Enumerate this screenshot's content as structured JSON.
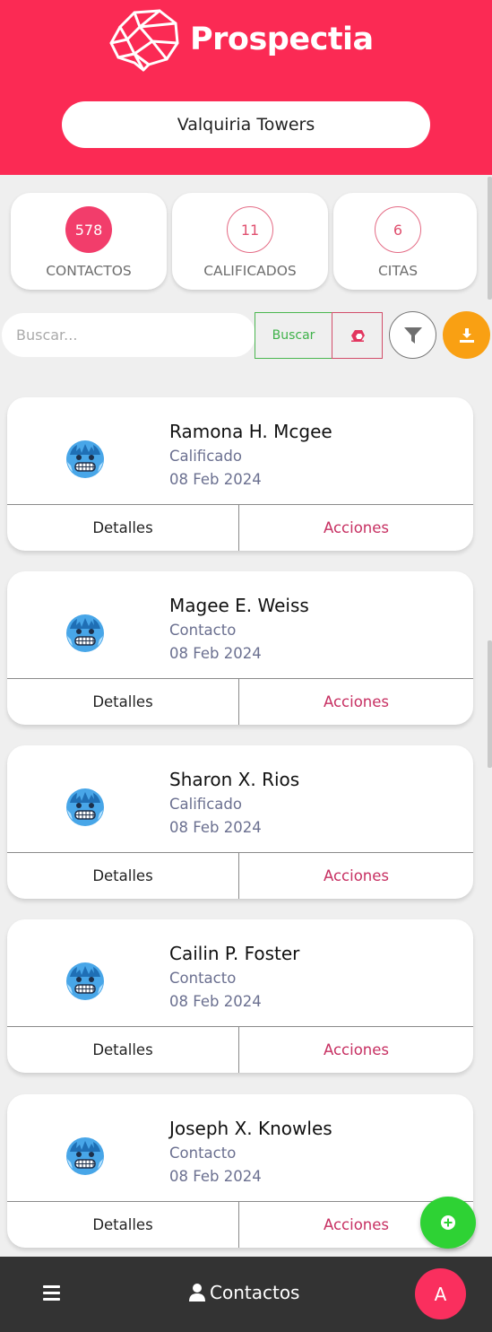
{
  "app": {
    "title": "Prospectia",
    "brand_color": "#fb2a54"
  },
  "project": {
    "name": "Valquiria Towers"
  },
  "stats": [
    {
      "value": "578",
      "label": "CONTACTOS",
      "style": "filled"
    },
    {
      "value": "11",
      "label": "CALIFICADOS",
      "style": "outline"
    },
    {
      "value": "6",
      "label": "CITAS",
      "style": "outline"
    }
  ],
  "search": {
    "placeholder": "Buscar...",
    "value": "",
    "button_label": "Buscar",
    "clear_icon": "eraser-icon",
    "filter_icon": "filter-icon",
    "download_icon": "download-icon"
  },
  "contacts": [
    {
      "name": "Ramona H. Mcgee",
      "status": "Calificado",
      "date": "08 Feb 2024",
      "avatar": "cold-face-icon",
      "details_label": "Detalles",
      "actions_label": "Acciones"
    },
    {
      "name": "Magee E. Weiss",
      "status": "Contacto",
      "date": "08 Feb 2024",
      "avatar": "cold-face-icon",
      "details_label": "Detalles",
      "actions_label": "Acciones"
    },
    {
      "name": "Sharon X. Rios",
      "status": "Calificado",
      "date": "08 Feb 2024",
      "avatar": "cold-face-icon",
      "details_label": "Detalles",
      "actions_label": "Acciones"
    },
    {
      "name": "Cailin P. Foster",
      "status": "Contacto",
      "date": "08 Feb 2024",
      "avatar": "cold-face-icon",
      "details_label": "Detalles",
      "actions_label": "Acciones"
    },
    {
      "name": "Joseph X. Knowles",
      "status": "Contacto",
      "date": "08 Feb 2024",
      "avatar": "cold-face-icon",
      "details_label": "Detalles",
      "actions_label": "Acciones"
    }
  ],
  "fab": {
    "icon": "plus-icon",
    "color": "#2ed234"
  },
  "bottom_nav": {
    "menu_icon": "hamburger-icon",
    "section_icon": "user-icon",
    "section_label": "Contactos",
    "user_initial": "A"
  }
}
